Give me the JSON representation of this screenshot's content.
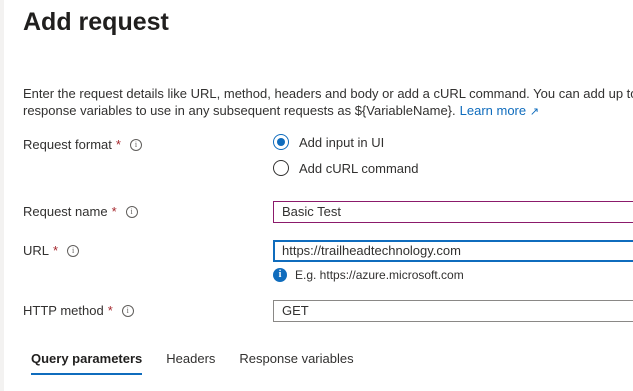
{
  "header": {
    "title": "Add request"
  },
  "description": {
    "line1": "Enter the request details like URL, method, headers and body or add a cURL command. You can add up to",
    "line2": "response variables to use in any subsequent requests as ${VariableName}.",
    "learn_more": "Learn more",
    "learn_more_icon": "external-link-icon"
  },
  "form": {
    "request_format": {
      "label": "Request format",
      "required": "*",
      "info": "i",
      "options": [
        {
          "label": "Add input in UI",
          "selected": true
        },
        {
          "label": "Add cURL command",
          "selected": false
        }
      ]
    },
    "request_name": {
      "label": "Request name",
      "required": "*",
      "info": "i",
      "value": "Basic Test"
    },
    "url": {
      "label": "URL",
      "required": "*",
      "info": "i",
      "value": "https://trailheadtechnology.com",
      "hint": "E.g. https://azure.microsoft.com",
      "hint_icon": "i"
    },
    "http_method": {
      "label": "HTTP method",
      "required": "*",
      "info": "i",
      "value": "GET"
    }
  },
  "tabs": [
    {
      "label": "Query parameters",
      "active": true
    },
    {
      "label": "Headers",
      "active": false
    },
    {
      "label": "Response variables",
      "active": false
    }
  ],
  "colors": {
    "accent": "#0f6cbd",
    "required": "#a4262c",
    "focus_border": "#8b1a6b"
  }
}
